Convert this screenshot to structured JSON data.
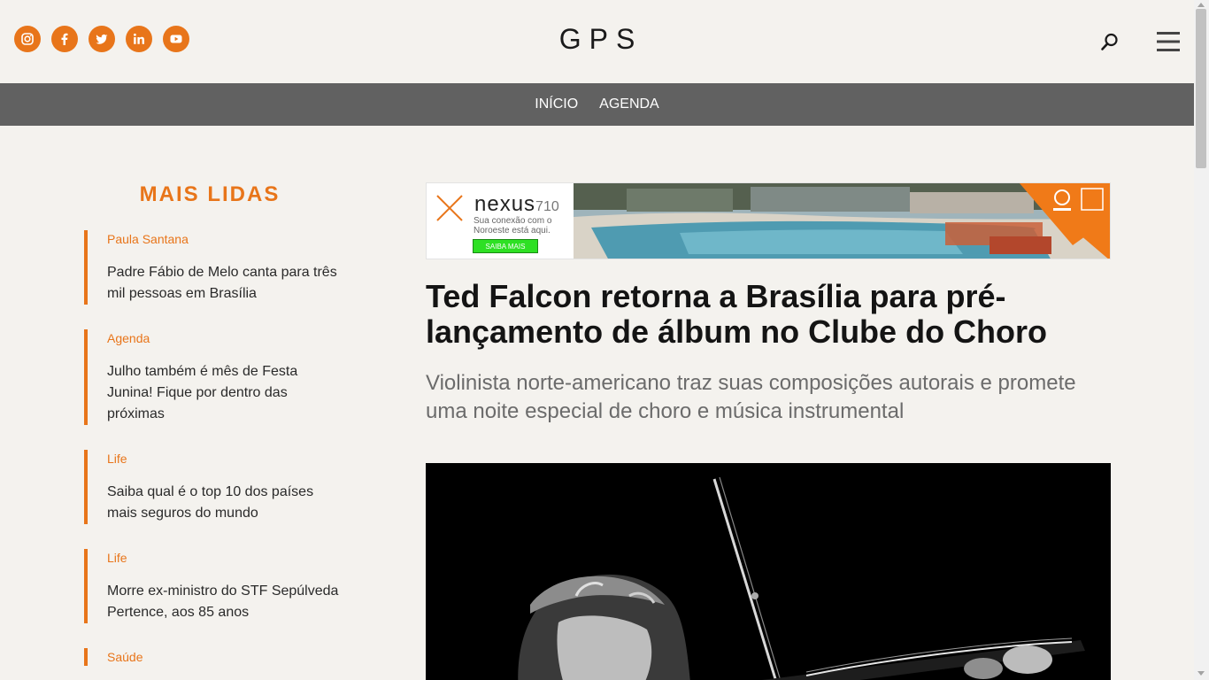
{
  "header": {
    "logo": "GPS",
    "social": [
      {
        "icon": "instagram-icon"
      },
      {
        "icon": "facebook-icon"
      },
      {
        "icon": "twitter-icon"
      },
      {
        "icon": "linkedin-icon"
      },
      {
        "icon": "youtube-icon"
      }
    ],
    "search_icon": "search-icon",
    "menu_icon": "hamburger-menu-icon"
  },
  "nav": {
    "items": [
      "INÍCIO",
      "AGENDA"
    ]
  },
  "sidebar": {
    "title": "MAIS LIDAS",
    "items": [
      {
        "category": "Paula Santana",
        "title": "Padre Fábio de Melo canta para três mil pessoas em Brasília"
      },
      {
        "category": "Agenda",
        "title": "Julho também é mês de Festa Junina! Fique por dentro das próximas"
      },
      {
        "category": "Life",
        "title": "Saiba qual é o top 10 dos países mais seguros do mundo"
      },
      {
        "category": "Life",
        "title": "Morre ex-ministro do STF Sepúlveda Pertence, aos 85 anos"
      },
      {
        "category": "Saúde",
        "title": ""
      }
    ]
  },
  "ad": {
    "brand": "nexus",
    "brand_suffix": "710",
    "tagline": "Sua conexão com o Noroeste está aqui.",
    "cta": "SAIBA MAIS"
  },
  "article": {
    "headline": "Ted Falcon retorna a Brasília para pré-lançamento de álbum no Clube do Choro",
    "subheadline": "Violinista norte-americano traz suas composições autorais e promete uma noite especial de choro e música instrumental"
  },
  "colors": {
    "accent": "#e8751a",
    "navbar": "#616161",
    "background": "#f4f2ee"
  }
}
